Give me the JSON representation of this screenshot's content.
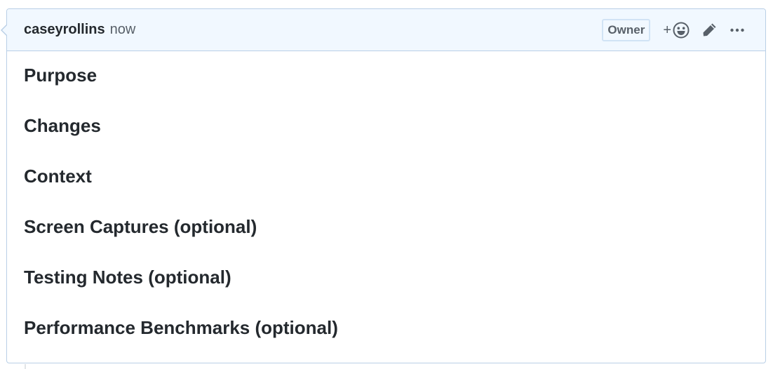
{
  "comment": {
    "author": "caseyrollins",
    "timestamp": "now",
    "badge": "Owner",
    "reaction_plus": "+",
    "sections": [
      "Purpose",
      "Changes",
      "Context",
      "Screen Captures (optional)",
      "Testing Notes (optional)",
      "Performance Benchmarks (optional)"
    ]
  },
  "colors": {
    "header_bg": "#f1f8ff",
    "border": "#b9cfe6",
    "text": "#24292e",
    "muted": "#586069"
  },
  "icons": {
    "reaction": "smiley-icon",
    "edit": "pencil-icon",
    "more": "kebab-horizontal-icon"
  }
}
